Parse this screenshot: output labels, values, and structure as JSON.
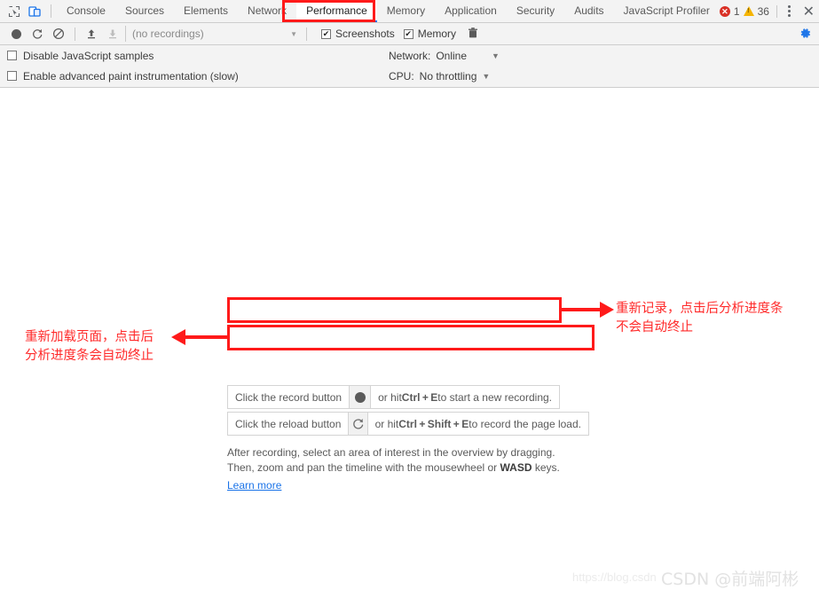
{
  "tabbar": {
    "icons": [
      {
        "name": "inspect-element-icon"
      },
      {
        "name": "device-toolbar-icon"
      }
    ],
    "tabs": [
      {
        "label": "Console",
        "active": false
      },
      {
        "label": "Sources",
        "active": false
      },
      {
        "label": "Elements",
        "active": false
      },
      {
        "label": "Network",
        "active": false
      },
      {
        "label": "Performance",
        "active": true
      },
      {
        "label": "Memory",
        "active": false
      },
      {
        "label": "Application",
        "active": false
      },
      {
        "label": "Security",
        "active": false
      },
      {
        "label": "Audits",
        "active": false
      },
      {
        "label": "JavaScript Profiler",
        "active": false
      }
    ],
    "error_count": "1",
    "warning_count": "36",
    "more_options_label": "⋮",
    "close_label": "✕"
  },
  "recbar": {
    "record_title": "record-button",
    "reload_title": "reload-button",
    "clear_title": "clear-button",
    "upload_title": "load-profile-button",
    "download_title": "save-profile-button",
    "recordings_value": "(no recordings)",
    "caret": "▼",
    "screenshots_label": "Screenshots",
    "screenshots_checked": true,
    "memory_label": "Memory",
    "memory_checked": true,
    "check_glyph": "✔",
    "trash_title": "delete-button",
    "gear_title": "settings-button"
  },
  "settings": {
    "disable_js_samples_label": "Disable JavaScript samples",
    "disable_js_samples_checked": false,
    "advanced_paint_label": "Enable advanced paint instrumentation (slow)",
    "advanced_paint_checked": false,
    "network_label": "Network:",
    "network_value": "Online",
    "cpu_label": "CPU:",
    "cpu_value": "No throttling",
    "dropdown_caret": "▼"
  },
  "main": {
    "record_hint_prefix": "Click the record button",
    "record_hint_suffix_a": "or hit ",
    "record_hint_keys": "Ctrl + E",
    "record_hint_suffix_b": " to start a new recording.",
    "reload_hint_prefix": "Click the reload button",
    "reload_hint_suffix_a": "or hit ",
    "reload_hint_keys_1": "Ctrl + Shift + E",
    "reload_hint_suffix_b": " to record the page load.",
    "paragraph_line1": "After recording, select an area of interest in the overview by dragging.",
    "paragraph_line2_a": "Then, zoom and pan the timeline with the mousewheel or ",
    "paragraph_line2_keys": "WASD",
    "paragraph_line2_b": " keys.",
    "learn_more": "Learn more"
  },
  "annotations": {
    "right_line1": "重新记录，点击后分析进度条",
    "right_line2": "不会自动终止",
    "left_line1": "重新加载页面，点击后",
    "left_line2": "分析进度条会自动终止",
    "color": "#ff2a2a"
  },
  "watermark": {
    "url": "https://blog.csdn",
    "brand": "CSDN @前端阿彬"
  }
}
